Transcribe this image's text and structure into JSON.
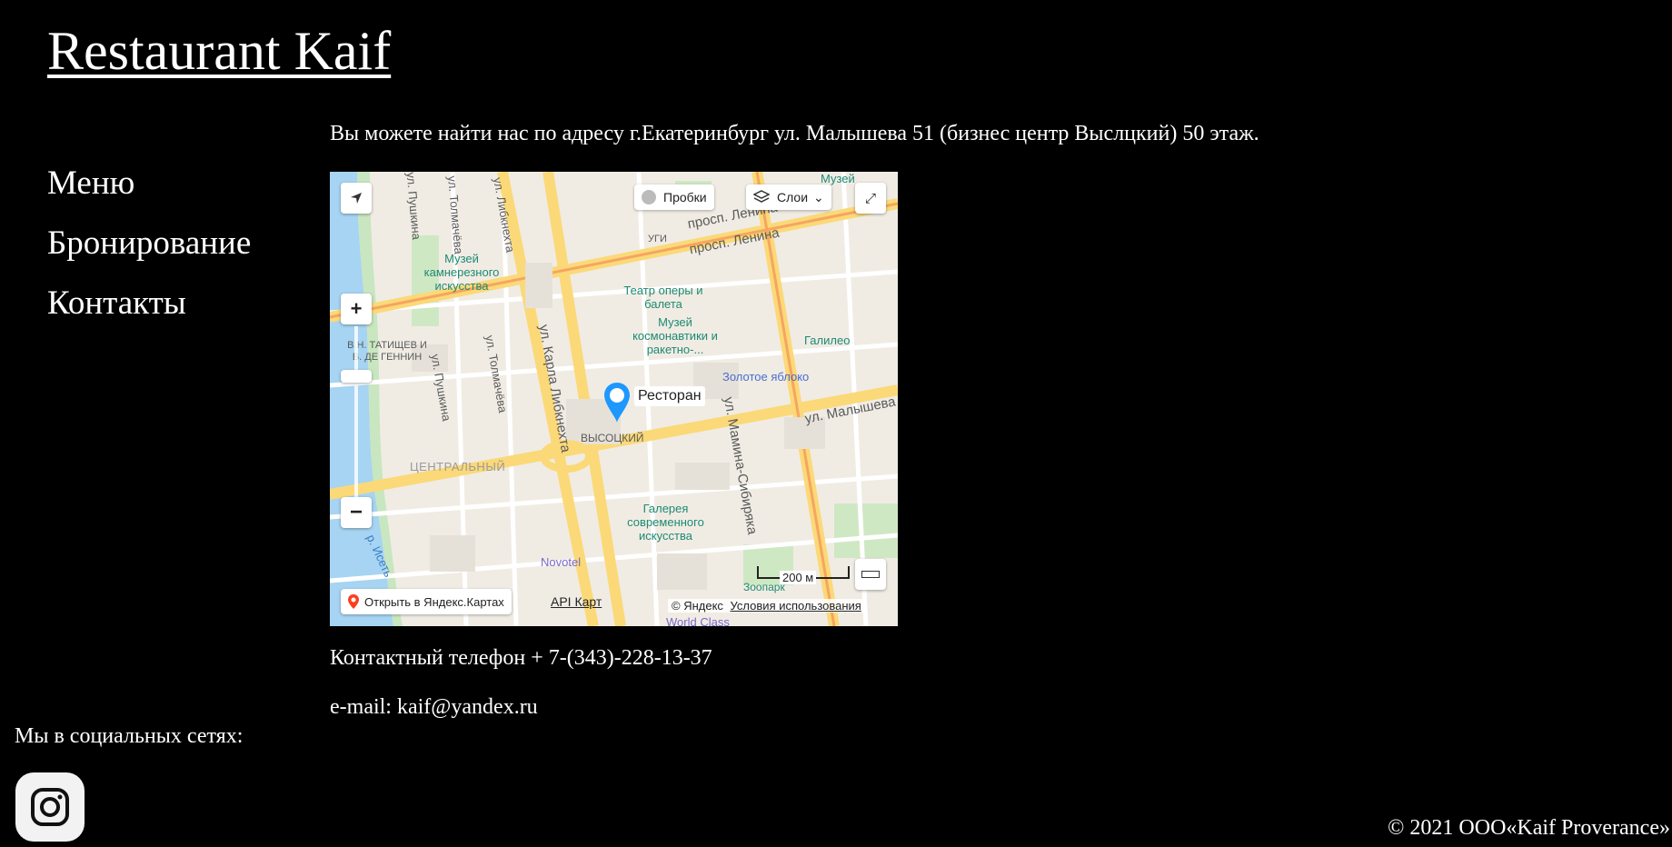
{
  "site": {
    "title": "Restaurant Kaif"
  },
  "nav": {
    "items": [
      "Меню",
      "Бронирование",
      "Контакты"
    ]
  },
  "address": "Вы можете найти нас по адресу г.Екатеринбург ул. Малышева 51 (бизнес центр Выслцкий) 50 этаж.",
  "map": {
    "traffic_label": "Пробки",
    "layers_label": "Слои",
    "pin_label": "Ресторан",
    "open_in_maps": "Открыть в Яндекс.Картах",
    "api_link": "API Карт",
    "copyright": "© Яндекс",
    "terms": "Условия использования",
    "scale": "200 м",
    "streets": {
      "lenina_1": "просп. Ленина",
      "lenina_2": "просп. Ленина",
      "malysheva": "ул. Малышева",
      "karla_libknekhta_1": "ул. Карла Либкнехта",
      "karla_libknekhta_2": "ул. Карла Либкнехта",
      "libknekhta_top": "ул. Либкнехта",
      "pushkina_1": "ул. Пушкина",
      "pushkina_2": "ул. Пушкина",
      "tolmacheva_1": "ул. Толмачёва",
      "tolmacheva_2": "ул. Толмачёва",
      "mamina": "ул. Мамина-Сибиряка",
      "iset": "р. Исеть",
      "ugi": "УГИ",
      "district": "ЦЕНТРАЛЬНЫЙ",
      "vysotsky": "ВЫСОЦКИЙ",
      "tatishchev": "В.Н. ТАТИЩЕВ И В. ДЕ ГЕННИН",
      "world_class": "World Class"
    },
    "pois": {
      "museum_stone": "Музей камнерезного искусства",
      "theatre": "Театр оперы и балета",
      "museum_space": "Музей космонавтики и ракетно-...",
      "galileo": "Галилео",
      "zolotoe": "Золотое яблоко",
      "gallery": "Галерея современного искусства",
      "novotel": "Novotel",
      "zoo": "Зоопарк",
      "museum_top": "Музей"
    }
  },
  "contacts": {
    "phone": "Контактный телефон + 7-(343)-228-13-37",
    "email": "e-mail: kaif@yandex.ru"
  },
  "social": {
    "label": "Мы в социальных сетях:"
  },
  "footer": {
    "copyright": "© 2021 ООО«Kaif Proverance»"
  }
}
